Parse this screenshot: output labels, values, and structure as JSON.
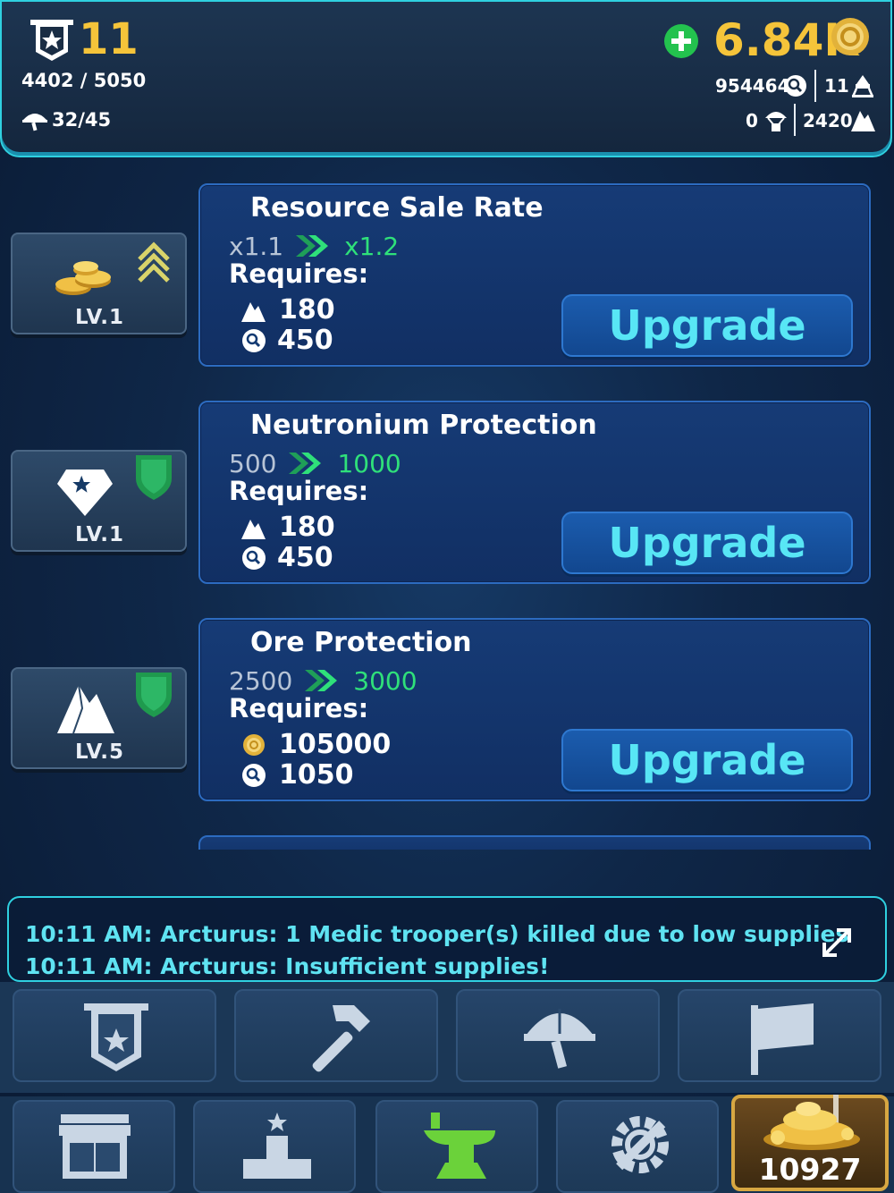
{
  "header": {
    "rank": "11",
    "xp": "4402 / 5050",
    "troops": "32/45",
    "coins": "6.84K",
    "research": "954464",
    "rockets": "11",
    "drops": "0",
    "ore": "2420"
  },
  "upgrades": [
    {
      "title": "Resource Sale Rate",
      "level": "LV.1",
      "from": "x1.1",
      "to": "x1.2",
      "requires_label": "Requires:",
      "req1": "180",
      "req2": "450",
      "req1_icon": "ore-icon",
      "req2_icon": "research-icon",
      "button": "Upgrade"
    },
    {
      "title": "Neutronium Protection",
      "level": "LV.1",
      "from": "500",
      "to": "1000",
      "requires_label": "Requires:",
      "req1": "180",
      "req2": "450",
      "req1_icon": "ore-icon",
      "req2_icon": "research-icon",
      "button": "Upgrade"
    },
    {
      "title": "Ore Protection",
      "level": "LV.5",
      "from": "2500",
      "to": "3000",
      "requires_label": "Requires:",
      "req1": "105000",
      "req2": "1050",
      "req1_icon": "coin-icon",
      "req2_icon": "research-icon",
      "button": "Upgrade"
    }
  ],
  "log": {
    "line1": "10:11 AM: Arcturus: 1 Medic trooper(s) killed due to low supplies",
    "line2": "10:11 AM: Arcturus: Insufficient supplies!"
  },
  "bottom": {
    "gold_count": "10927"
  },
  "colors": {
    "accent_cyan": "#2fd0e0",
    "gold": "#f5c43a",
    "green": "#2fe07a"
  }
}
